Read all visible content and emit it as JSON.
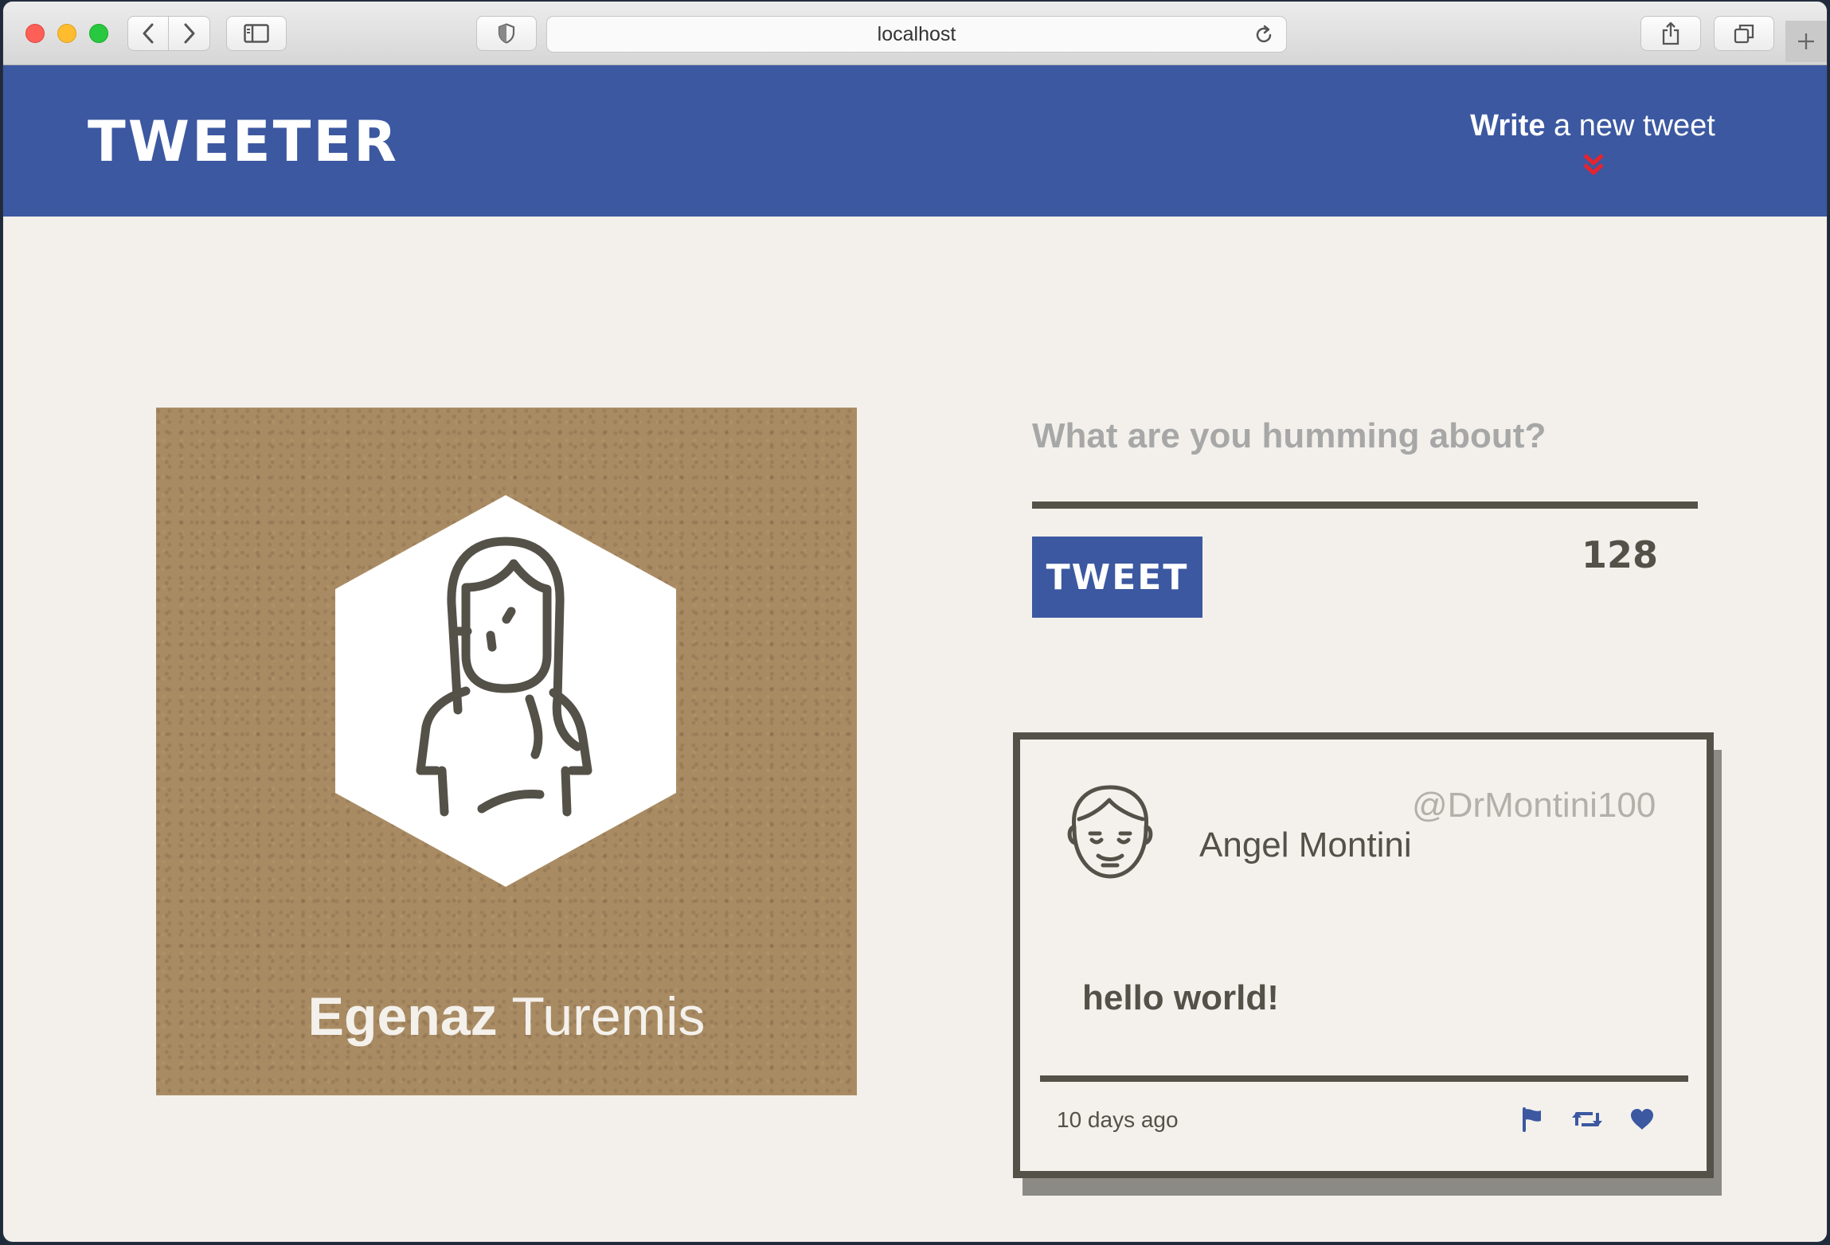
{
  "browser": {
    "url": "localhost"
  },
  "header": {
    "logo": "TWEETER",
    "compose_bold": "Write",
    "compose_rest": " a new tweet"
  },
  "profile": {
    "first_name": "Egenaz",
    "last_name": "Turemis"
  },
  "compose": {
    "placeholder": "What are you humming about?",
    "button_label": "TWEET",
    "char_count": "128"
  },
  "tweet": {
    "author_name": "Angel Montini",
    "handle": "@DrMontini100",
    "content": "hello world!",
    "timestamp": "10 days ago"
  },
  "colors": {
    "brand": "#3c58a1",
    "ink": "#545149",
    "background": "#f3f0eb",
    "accent": "#e4242f"
  },
  "icons": {
    "compose_arrow": "double-chevron-down-icon",
    "tweet_actions": [
      "flag-icon",
      "retweet-icon",
      "heart-icon"
    ]
  }
}
